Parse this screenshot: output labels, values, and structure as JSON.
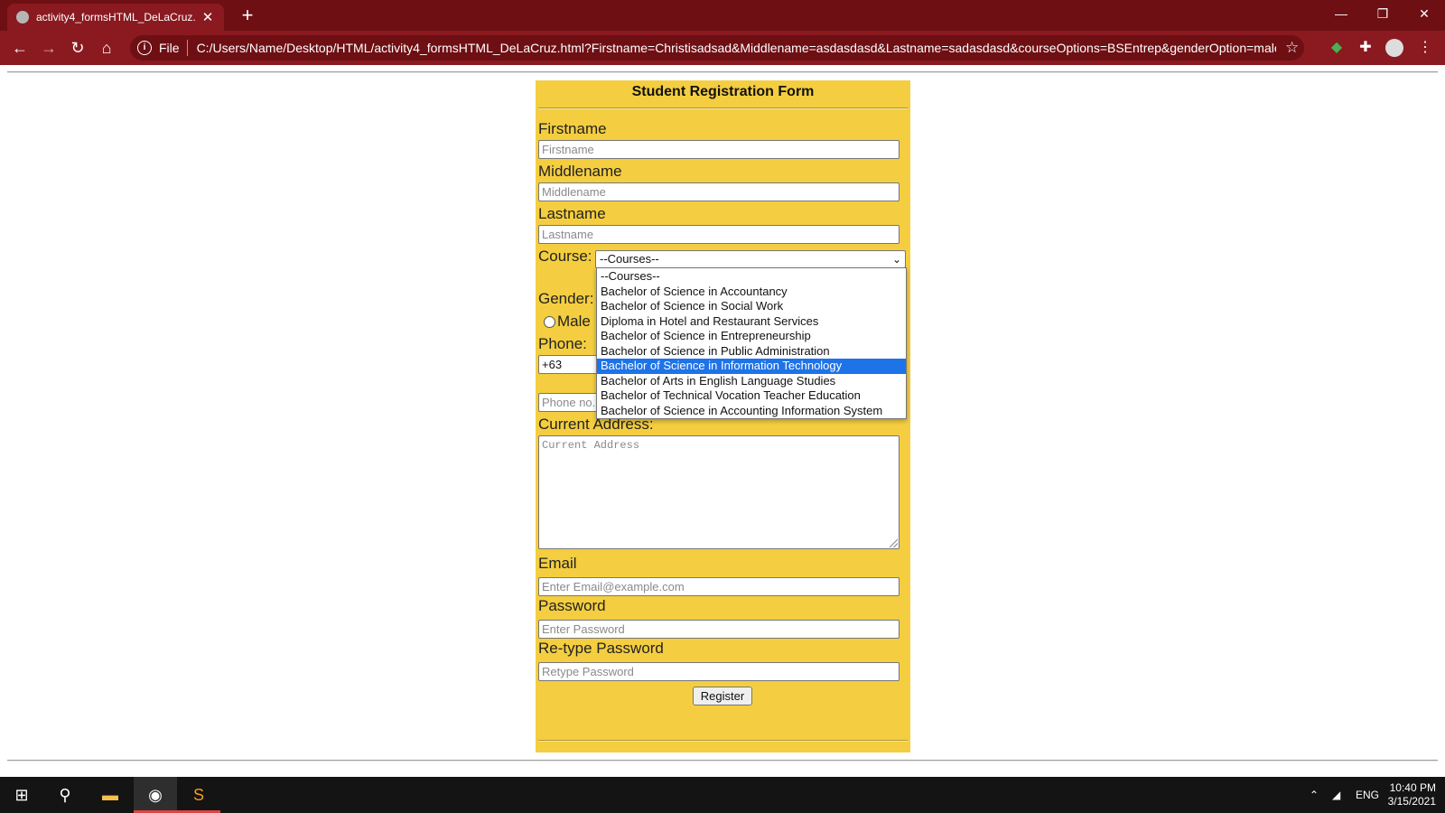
{
  "browser": {
    "tab_title": "activity4_formsHTML_DeLaCruz.h",
    "new_tab": "+",
    "scheme": "File",
    "url": "C:/Users/Name/Desktop/HTML/activity4_formsHTML_DeLaCruz.html?Firstname=Christisadsad&Middlename=asdasdasd&Lastname=sadasdasd&courseOptions=BSEntrep&genderOption=male...",
    "icons": [
      "back-icon",
      "forward-icon",
      "reload-icon",
      "home-icon",
      "info-icon",
      "star-icon",
      "extension-icon",
      "puzzle-icon",
      "profile-icon",
      "menu-icon"
    ]
  },
  "form": {
    "title": "Student Registration Form",
    "firstname": {
      "label": "Firstname",
      "placeholder": "Firstname"
    },
    "middlename": {
      "label": "Middlename",
      "placeholder": "Middlename"
    },
    "lastname": {
      "label": "Lastname",
      "placeholder": "Lastname"
    },
    "course": {
      "label": "Course:",
      "selected": "--Courses--",
      "options": [
        "--Courses--",
        "Bachelor of Science in Accountancy",
        "Bachelor of Science in Social Work",
        "Diploma in Hotel and Restaurant Services",
        "Bachelor of Science in Entrepreneurship",
        "Bachelor of Science in Public Administration",
        "Bachelor of Science in Information Technology",
        "Bachelor of Arts in English Language Studies",
        "Bachelor of Technical Vocation Teacher Education",
        "Bachelor of Science in Accounting Information System"
      ],
      "highlighted_index": 6,
      "highlight_color": "#1e73e8"
    },
    "gender": {
      "label": "Gender:",
      "male": "Male"
    },
    "phone": {
      "label": "Phone:",
      "code": "+63",
      "placeholder": "Phone no."
    },
    "address": {
      "label": "Current Address:",
      "placeholder": "Current Address"
    },
    "email": {
      "label": "Email",
      "placeholder": "Enter Email@example.com"
    },
    "password": {
      "label": "Password",
      "placeholder": "Enter Password"
    },
    "retype": {
      "label": "Re-type Password",
      "placeholder": "Retype Password"
    },
    "register_label": "Register",
    "panel_color": "#f4ce40"
  },
  "taskbar": {
    "lang": "ENG",
    "time": "10:40 PM",
    "date": "3/15/2021",
    "icons": [
      "windows-start-icon",
      "search-icon",
      "file-explorer-icon",
      "chrome-icon",
      "sublime-text-icon"
    ]
  }
}
